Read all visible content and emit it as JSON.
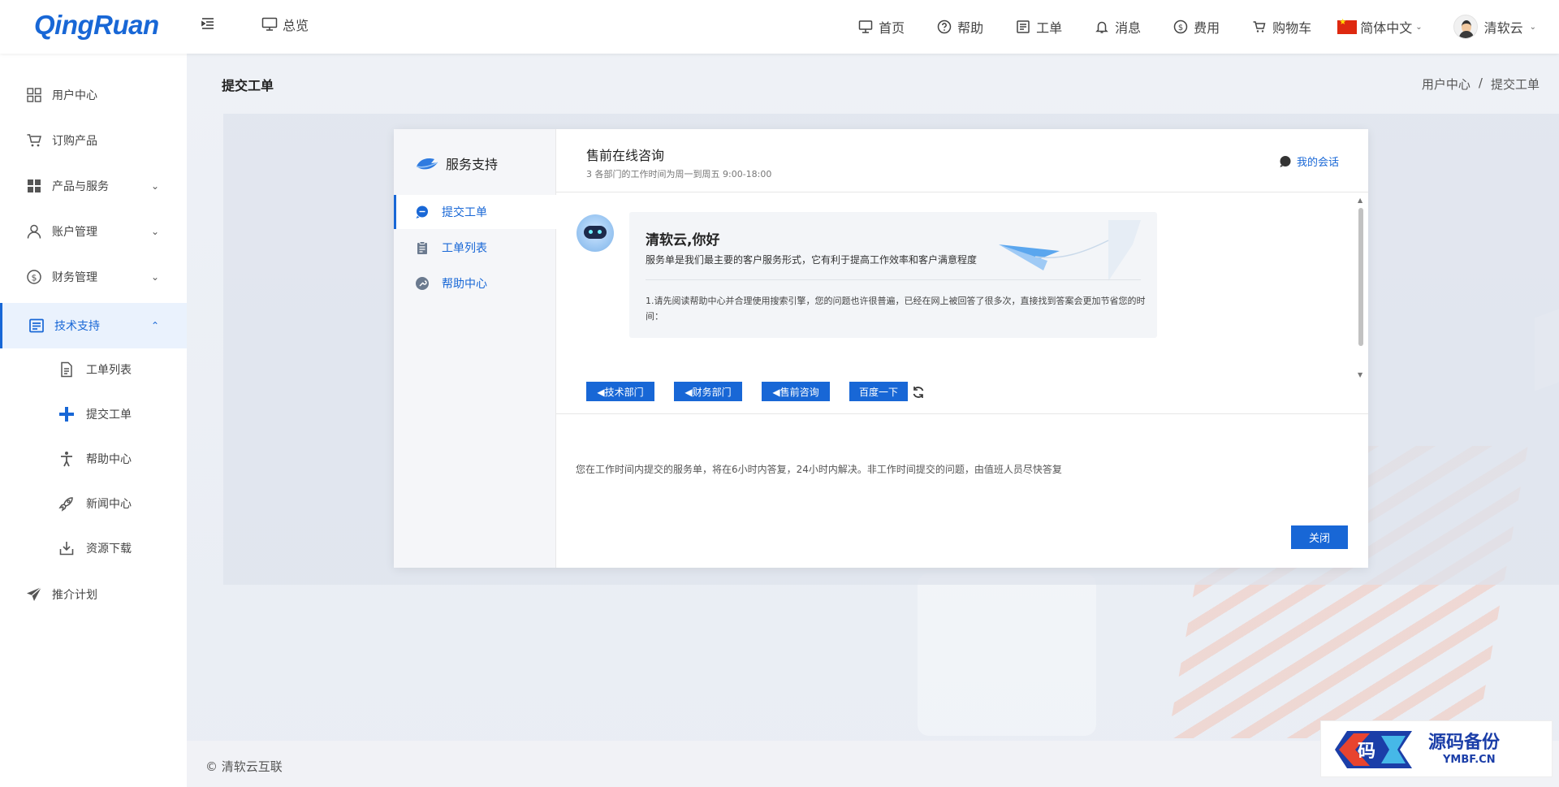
{
  "header": {
    "logo": "QingRuan",
    "overview": "总览",
    "nav": [
      {
        "label": "首页",
        "icon": "monitor-icon"
      },
      {
        "label": "帮助",
        "icon": "help-circle-icon"
      },
      {
        "label": "工单",
        "icon": "ticket-icon"
      },
      {
        "label": "消息",
        "icon": "bell-icon"
      },
      {
        "label": "费用",
        "icon": "dollar-icon"
      },
      {
        "label": "购物车",
        "icon": "cart-icon"
      }
    ],
    "language": "简体中文",
    "user": "清软云"
  },
  "sidebar": {
    "items": [
      {
        "label": "用户中心",
        "icon": "grid-icon"
      },
      {
        "label": "订购产品",
        "icon": "cart-icon"
      },
      {
        "label": "产品与服务",
        "icon": "apps-icon"
      },
      {
        "label": "账户管理",
        "icon": "user-icon"
      },
      {
        "label": "财务管理",
        "icon": "dollar-icon"
      },
      {
        "label": "技术支持",
        "icon": "support-icon"
      }
    ],
    "sub_items": [
      {
        "label": "工单列表",
        "icon": "document-icon"
      },
      {
        "label": "提交工单",
        "icon": "plus-icon"
      },
      {
        "label": "帮助中心",
        "icon": "person-icon"
      },
      {
        "label": "新闻中心",
        "icon": "rocket-icon"
      },
      {
        "label": "资源下载",
        "icon": "download-icon"
      }
    ],
    "referral": {
      "label": "推介计划",
      "icon": "send-icon"
    }
  },
  "page": {
    "title": "提交工单",
    "breadcrumb": [
      "用户中心",
      "/",
      "提交工单"
    ]
  },
  "dialog": {
    "brand": "服务支持",
    "menu": [
      {
        "label": "提交工单",
        "icon": "chat-icon"
      },
      {
        "label": "工单列表",
        "icon": "clipboard-icon"
      },
      {
        "label": "帮助中心",
        "icon": "wrench-icon"
      }
    ],
    "title": "售前在线咨询",
    "subtitle": "3 各部门的工作时间为周一到周五 9:00-18:00",
    "my_chat": "我的会话",
    "greeting": "清软云,你好",
    "intro": "服务单是我们最主要的客户服务形式，它有利于提高工作效率和客户满意程度",
    "tip": "1.请先阅读帮助中心并合理使用搜索引擎，您的问题也许很普遍，已经在网上被回答了很多次，直接找到答案会更加节省您的时间：",
    "departments": [
      "◀技术部门",
      "◀财务部门",
      "◀售前咨询",
      "百度一下"
    ],
    "notice": "您在工作时间内提交的服务单，将在6小时内答复，24小时内解决。非工作时间提交的问题，由值班人员尽快答复",
    "close": "关闭"
  },
  "footer": {
    "copyright": "© 清软云互联"
  },
  "watermark": {
    "text": "源码备份",
    "url": "YMBF.CN"
  },
  "colors": {
    "accent": "#1867d6",
    "sidebar_active_bg": "#eaf2fd",
    "page_bg": "#eef1f6"
  }
}
